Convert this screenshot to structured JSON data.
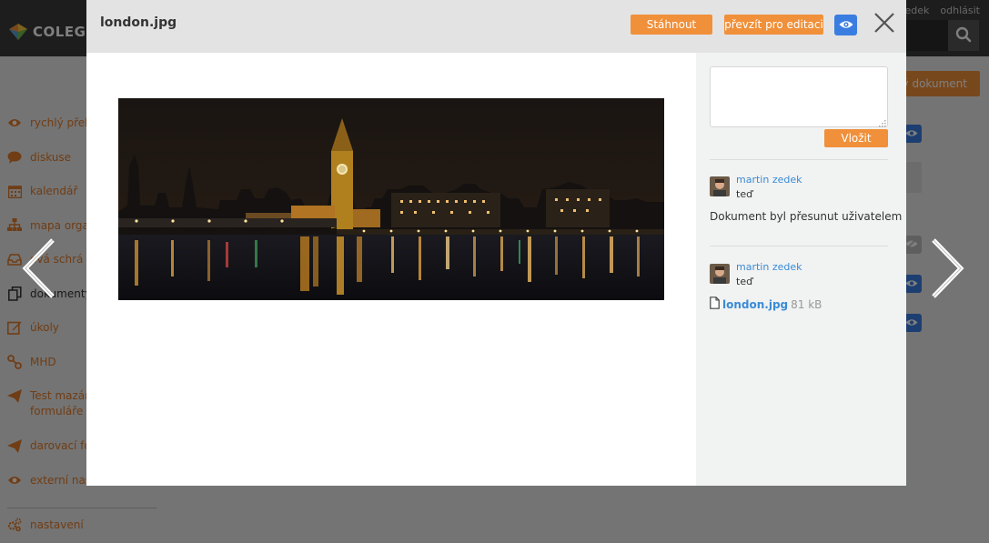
{
  "app": {
    "logo_text": "COLEGIO",
    "user_name": "zedek",
    "logout_label": "odhlásit",
    "new_document_label": "ý dokument"
  },
  "sidebar": {
    "items": [
      {
        "label": "rychlý přeh",
        "icon": "eye-icon"
      },
      {
        "label": "diskuse",
        "icon": "chat-bubble-icon"
      },
      {
        "label": "kalendář",
        "icon": "calendar-icon"
      },
      {
        "label": "mapa orga",
        "icon": "org-chart-icon"
      },
      {
        "label": "ová schrá",
        "icon": "inbox-icon"
      },
      {
        "label": "dokumenty",
        "icon": "documents-icon"
      },
      {
        "label": "úkoly",
        "icon": "edit-icon"
      },
      {
        "label": "MHD",
        "icon": "route-icon"
      },
      {
        "label": "Test mazán",
        "label2": "formuláře",
        "icon": "paper-plane-icon"
      },
      {
        "label": "darovací fo",
        "icon": "paper-plane-icon"
      },
      {
        "label": "externí nast",
        "icon": "eye-icon"
      }
    ],
    "settings_label": "nastavení"
  },
  "modal": {
    "title": "london.jpg",
    "download_label": "Stáhnout",
    "take_for_edit_label": "převzít pro editaci",
    "comment_placeholder": "",
    "insert_label": "Vložit",
    "comments": [
      {
        "author": "martin zedek",
        "time": "teď",
        "text": "Dokument byl přesunut uživatelem"
      },
      {
        "author": "martin zedek",
        "time": "teď",
        "file_name": "london.jpg",
        "file_size": "81 kB"
      }
    ]
  },
  "colors": {
    "accent_orange": "#f0903a",
    "accent_blue": "#3a7de0",
    "link_blue": "#3a8bd6"
  }
}
